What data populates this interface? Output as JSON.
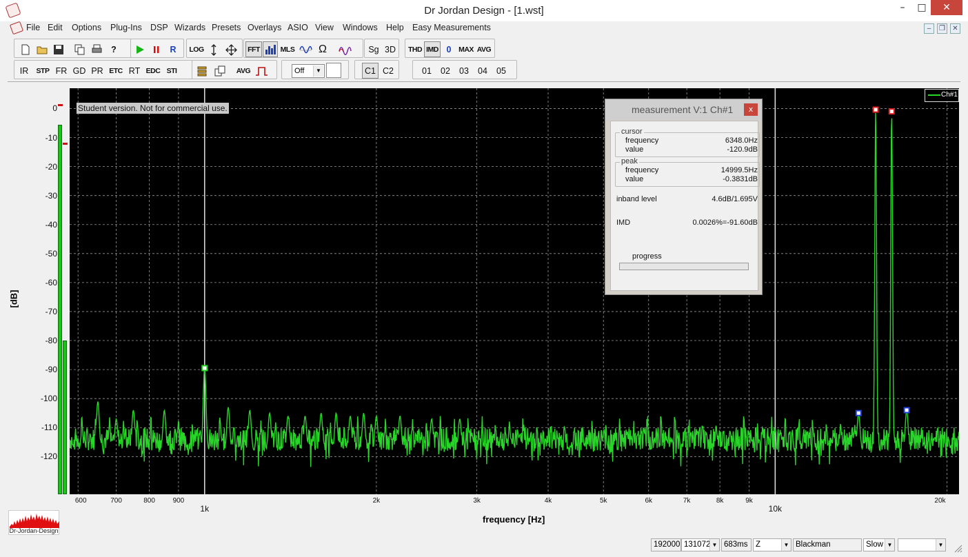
{
  "window": {
    "title": "Dr Jordan Design - [1.wst]",
    "minimize_glyph": "–",
    "maximize_glyph": "□",
    "close_glyph": "✕",
    "mdi_minimize_glyph": "–",
    "mdi_restore_glyph": "❐",
    "mdi_close_glyph": "✕"
  },
  "menu": {
    "items": [
      "File",
      "Edit",
      "Options",
      "Plug-Ins",
      "DSP",
      "Wizards",
      "Presets",
      "Overlays",
      "ASIO",
      "View",
      "Windows",
      "Help",
      "Easy Measurements"
    ]
  },
  "toolbar1": {
    "log": "LOG",
    "fft": "FFT",
    "mls": "MLS",
    "omega": "Ω",
    "sg": "Sg",
    "threed": "3D",
    "thd": "THD",
    "imd": "IMD",
    "zero": "0",
    "max": "MAX",
    "avg": "AVG",
    "r": "R"
  },
  "toolbar2": {
    "ir": "IR",
    "stp": "STP",
    "fr": "FR",
    "gd": "GD",
    "pr": "PR",
    "etc": "ETC",
    "rt": "RT",
    "edc": "EDC",
    "sti": "STI",
    "avg": "AVG",
    "off_select": "Off",
    "c1": "C1",
    "c2": "C2",
    "o1": "01",
    "o2": "02",
    "o3": "03",
    "o4": "04",
    "o5": "05"
  },
  "plot": {
    "student_note": "Student version. Not for commercial use.",
    "legend": "Ch#1",
    "y_axis_title": "[dB]",
    "x_axis_title": "frequency [Hz]",
    "y_ticks": [
      "0",
      "-10",
      "-20",
      "-30",
      "-40",
      "-50",
      "-60",
      "-70",
      "-80",
      "-90",
      "-100",
      "-110",
      "-120"
    ],
    "x_ticks_minor": [
      "600",
      "700",
      "800",
      "900",
      "2k",
      "3k",
      "4k",
      "5k",
      "6k",
      "7k",
      "8k",
      "9k",
      "20k"
    ],
    "x_ticks_major": [
      "1k",
      "10k"
    ],
    "trace_color": "#2ad52a"
  },
  "chart_data": {
    "type": "line",
    "xlabel": "frequency [Hz]",
    "ylabel": "[dB]",
    "x_scale": "log",
    "xlim": [
      580,
      21000
    ],
    "ylim": [
      -133,
      7
    ],
    "grid": true,
    "legend_position": "top-right",
    "series": [
      {
        "name": "Ch#1",
        "points": [
          [
            585,
            -116
          ],
          [
            600,
            -118
          ],
          [
            620,
            -110
          ],
          [
            650,
            -101
          ],
          [
            680,
            -115
          ],
          [
            700,
            -107
          ],
          [
            750,
            -104
          ],
          [
            800,
            -111
          ],
          [
            850,
            -104
          ],
          [
            900,
            -108
          ],
          [
            950,
            -112
          ],
          [
            1000,
            -89.5
          ],
          [
            1050,
            -117
          ],
          [
            1100,
            -103
          ],
          [
            1200,
            -104
          ],
          [
            1300,
            -105
          ],
          [
            1400,
            -106
          ],
          [
            1500,
            -106
          ],
          [
            1600,
            -105
          ],
          [
            1700,
            -105
          ],
          [
            1800,
            -106
          ],
          [
            1900,
            -105
          ],
          [
            2000,
            -106
          ],
          [
            2200,
            -106
          ],
          [
            2500,
            -107
          ],
          [
            2800,
            -107
          ],
          [
            3000,
            -108
          ],
          [
            3500,
            -108
          ],
          [
            4000,
            -109
          ],
          [
            4500,
            -109
          ],
          [
            5000,
            -110
          ],
          [
            6000,
            -110
          ],
          [
            7000,
            -111
          ],
          [
            8000,
            -111
          ],
          [
            9000,
            -112
          ],
          [
            10000,
            -110
          ],
          [
            11000,
            -112
          ],
          [
            12000,
            -112
          ],
          [
            13000,
            -112
          ],
          [
            14000,
            -105
          ],
          [
            15000,
            -0.3831
          ],
          [
            15500,
            -118
          ],
          [
            16000,
            -1
          ],
          [
            17000,
            -104
          ],
          [
            18000,
            -113
          ],
          [
            19000,
            -112
          ],
          [
            20000,
            -115
          ],
          [
            21000,
            -113
          ]
        ]
      }
    ],
    "markers": [
      {
        "x": 1000,
        "y": -89.5,
        "color": "#2ad52a"
      },
      {
        "x": 15000,
        "y": -0.3831,
        "color": "#e02020"
      },
      {
        "x": 16000,
        "y": -1,
        "color": "#e02020"
      },
      {
        "x": 14000,
        "y": -105,
        "color": "#2040e0"
      },
      {
        "x": 17000,
        "y": -104,
        "color": "#2040e0"
      }
    ],
    "cursor_lines_x": [
      1000,
      10000
    ]
  },
  "dialog": {
    "title": "measurement V:1 Ch#1",
    "close_glyph": "x",
    "cursor_label": "cursor",
    "cursor_frequency_label": "frequency",
    "cursor_frequency": "6348.0Hz",
    "cursor_value_label": "value",
    "cursor_value": "-120.9dB",
    "peak_label": "peak",
    "peak_frequency_label": "frequency",
    "peak_frequency": "14999.5Hz",
    "peak_value_label": "value",
    "peak_value": "-0.3831dB",
    "inband_label": "inband level",
    "inband_value": "4.6dB/1.695V",
    "imd_label": "IMD",
    "imd_value": "0.0026%=-91.60dB",
    "progress_label": "progress",
    "progress_fraction": 0
  },
  "logo": {
    "text": "Dr-Jordan-Design",
    "color": "#e01010"
  },
  "status": {
    "sample_rate": "192000",
    "fft_size": "131072",
    "duration": "683ms",
    "weighting": "Z",
    "window": "Blackman",
    "speed": "Slow",
    "extra": ""
  }
}
